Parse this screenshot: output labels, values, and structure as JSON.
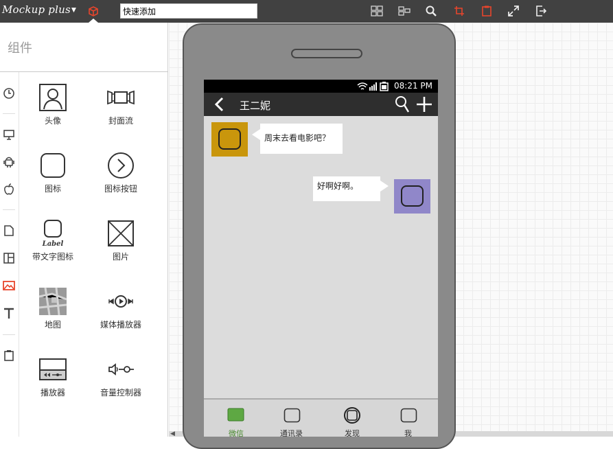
{
  "app": {
    "name": "Mockup plus",
    "accent": "#e8452c"
  },
  "toolbar": {
    "quick_add_value": "快速添加",
    "icons": [
      "layout-icon",
      "align-icon",
      "search-icon",
      "crop-icon",
      "clipboard-icon",
      "expand-icon",
      "export-icon"
    ]
  },
  "panel": {
    "title": "组件",
    "sidebar_icons": [
      "clock-icon",
      "desktop-icon",
      "android-icon",
      "apple-icon",
      "page-icon",
      "layout-panel-icon",
      "image-icon",
      "text-icon",
      "clipboard-icon"
    ],
    "components": [
      {
        "label": "头像",
        "icon": "avatar-icon"
      },
      {
        "label": "封面流",
        "icon": "coverflow-icon"
      },
      {
        "label": "图标",
        "icon": "rounded-square-icon"
      },
      {
        "label": "图标按钮",
        "icon": "circle-arrow-icon"
      },
      {
        "label": "带文字图标",
        "icon": "label-icon",
        "icon_text": "Label"
      },
      {
        "label": "图片",
        "icon": "image-placeholder-icon"
      },
      {
        "label": "地图",
        "icon": "map-icon"
      },
      {
        "label": "媒体播放器",
        "icon": "media-player-icon"
      },
      {
        "label": "播放器",
        "icon": "player-icon"
      },
      {
        "label": "音量控制器",
        "icon": "volume-control-icon"
      }
    ]
  },
  "phone": {
    "status_time": "08:21 PM",
    "nav_title": "王二妮",
    "messages": [
      {
        "side": "left",
        "text": "周末去看电影吧？",
        "avatar_color": "#c9960c"
      },
      {
        "side": "right",
        "text": "好啊好啊。",
        "avatar_color": "#9087c9"
      }
    ],
    "tabs": [
      {
        "label": "微信",
        "icon": "chat-tab-icon",
        "active": true
      },
      {
        "label": "通讯录",
        "icon": "contacts-tab-icon",
        "active": false
      },
      {
        "label": "发现",
        "icon": "discover-tab-icon",
        "active": false
      },
      {
        "label": "我",
        "icon": "me-tab-icon",
        "active": false
      }
    ]
  }
}
